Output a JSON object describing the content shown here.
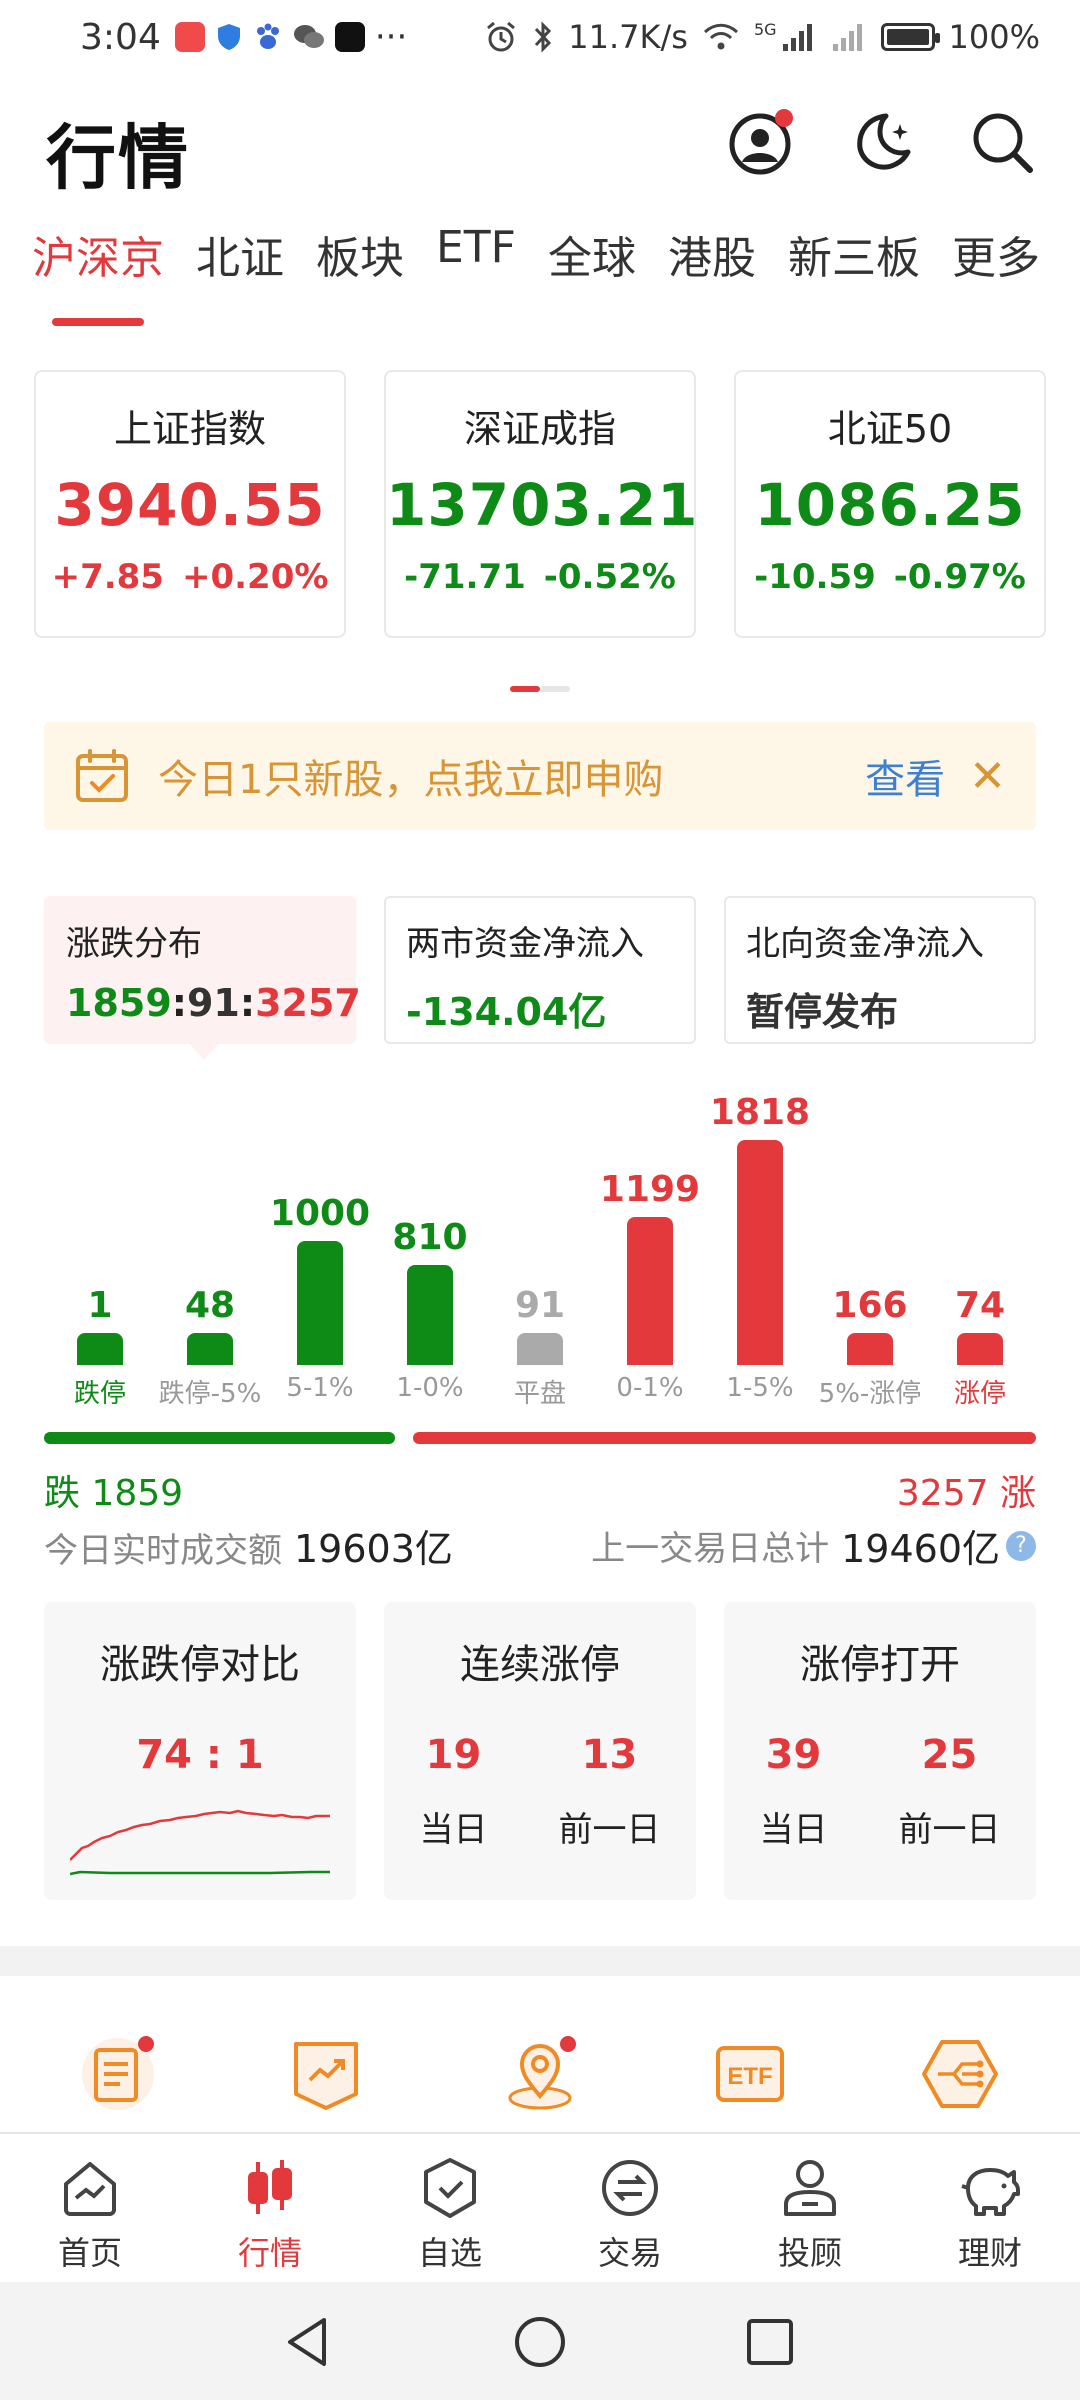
{
  "status_bar": {
    "time": "3:04",
    "more": "···",
    "net_speed": "11.7K/s",
    "net_type": "5G",
    "battery": "100%"
  },
  "header": {
    "title": "行情"
  },
  "tabs": [
    "沪深京",
    "北证",
    "板块",
    "ETF",
    "全球",
    "港股",
    "新三板",
    "更多"
  ],
  "indices": [
    {
      "name": "上证指数",
      "value": "3940.55",
      "change": "+7.85",
      "pct": "+0.20%",
      "trend": "up"
    },
    {
      "name": "深证成指",
      "value": "13703.21",
      "change": "-71.71",
      "pct": "-0.52%",
      "trend": "down"
    },
    {
      "name": "北证50",
      "value": "1086.25",
      "change": "-10.59",
      "pct": "-0.97%",
      "trend": "down"
    }
  ],
  "banner": {
    "text": "今日1只新股，点我立即申购",
    "link": "查看",
    "close": "✕"
  },
  "stats": [
    {
      "label": "涨跌分布",
      "down": "1859",
      "flat": "91",
      "up": "3257",
      "sep": ":"
    },
    {
      "label": "两市资金净流入",
      "value": "-134.04亿"
    },
    {
      "label": "北向资金净流入",
      "value": "暂停发布"
    }
  ],
  "chart_data": {
    "type": "bar",
    "categories": [
      "跌停",
      "跌停-5%",
      "5-1%",
      "1-0%",
      "平盘",
      "0-1%",
      "1-5%",
      "5%-涨停",
      "涨停"
    ],
    "values": [
      1,
      48,
      1000,
      810,
      91,
      1199,
      1818,
      166,
      74
    ],
    "ylim": [
      0,
      1818
    ],
    "colors": [
      "#0e8a16",
      "#0e8a16",
      "#0e8a16",
      "#0e8a16",
      "#aaaaaa",
      "#e4393c",
      "#e4393c",
      "#e4393c",
      "#e4393c"
    ]
  },
  "rise_fall": {
    "down_label": "跌",
    "down_count": "1859",
    "up_count": "3257",
    "up_label": "涨",
    "down_share": 0.363
  },
  "turnover": {
    "today_label": "今日实时成交额",
    "today_value": "19603亿",
    "prev_label": "上一交易日总计",
    "prev_value": "19460亿",
    "help": "?"
  },
  "limit_compare": {
    "title": "涨跌停对比",
    "ratio": "74 : 1"
  },
  "consecutive": {
    "title": "连续涨停",
    "today": "19",
    "prev": "13",
    "today_label": "当日",
    "prev_label": "前一日"
  },
  "limit_open": {
    "title": "涨停打开",
    "today": "39",
    "prev": "25",
    "today_label": "当日",
    "prev_label": "前一日"
  },
  "shortcuts": {
    "icons": [
      "news-icon",
      "trend-board-icon",
      "location-icon",
      "etf-icon",
      "network-icon"
    ],
    "etf_text": "ETF"
  },
  "bottom_nav": [
    "首页",
    "行情",
    "自选",
    "交易",
    "投顾",
    "理财"
  ],
  "colors": {
    "up": "#e4393c",
    "down": "#0e8a16",
    "flat": "#aaaaaa",
    "accent": "#f08a24",
    "link": "#3d7fd1"
  }
}
